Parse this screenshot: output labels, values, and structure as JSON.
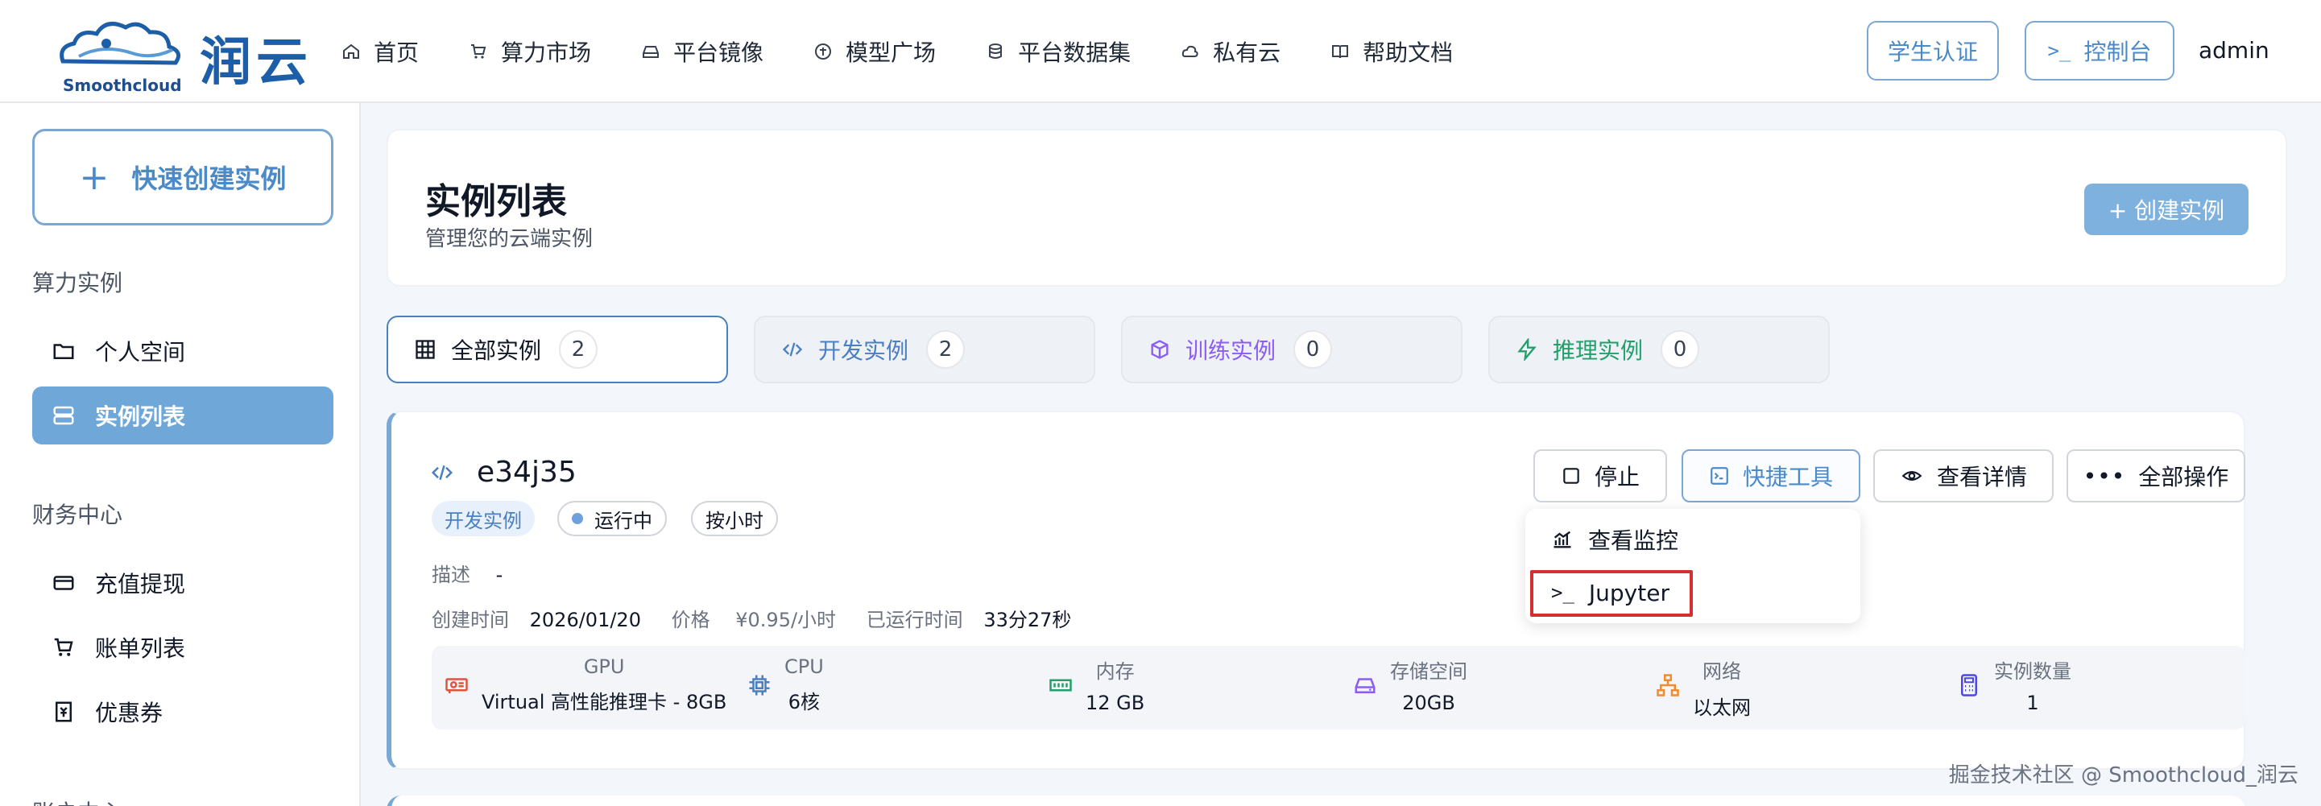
{
  "brand": {
    "name_cn": "润云",
    "name_en": "Smoothcloud"
  },
  "nav": {
    "items": [
      {
        "label": "首页",
        "icon": "home-icon"
      },
      {
        "label": "算力市场",
        "icon": "cart-icon"
      },
      {
        "label": "平台镜像",
        "icon": "drive-icon"
      },
      {
        "label": "模型广场",
        "icon": "model-icon"
      },
      {
        "label": "平台数据集",
        "icon": "database-icon"
      },
      {
        "label": "私有云",
        "icon": "cloud-icon"
      },
      {
        "label": "帮助文档",
        "icon": "book-icon"
      }
    ],
    "student_auth": "学生认证",
    "console": "控制台",
    "user": "admin"
  },
  "sidebar": {
    "quick_create": "快速创建实例",
    "sections": [
      {
        "title": "算力实例",
        "items": [
          "个人空间",
          "实例列表"
        ]
      },
      {
        "title": "财务中心",
        "items": [
          "充值提现",
          "账单列表",
          "优惠券"
        ]
      },
      {
        "title": "账户中心"
      }
    ],
    "active": "实例列表"
  },
  "page": {
    "title": "实例列表",
    "subtitle": "管理您的云端实例",
    "create_button": "+ 创建实例"
  },
  "tabs": [
    {
      "label": "全部实例",
      "count": "2",
      "color": "#111827"
    },
    {
      "label": "开发实例",
      "count": "2",
      "color": "#4a7fc1"
    },
    {
      "label": "训练实例",
      "count": "0",
      "color": "#8b5cf6"
    },
    {
      "label": "推理实例",
      "count": "0",
      "color": "#22a06b"
    }
  ],
  "instance": {
    "name": "e34j35",
    "type_badge": "开发实例",
    "status": "运行中",
    "billing": "按小时",
    "desc_label": "描述",
    "desc_value": "-",
    "created_label": "创建时间",
    "created_value": "2026/01/20",
    "price_label": "价格",
    "price_value": "¥0.95/小时",
    "runtime_label": "已运行时间",
    "runtime_value": "33分27秒",
    "actions": {
      "stop": "停止",
      "quick_tools": "快捷工具",
      "details": "查看详情",
      "all_ops": "全部操作"
    },
    "dropdown": {
      "monitor": "查看监控",
      "jupyter": "Jupyter"
    },
    "specs": [
      {
        "label": "GPU",
        "value": "Virtual 高性能推理卡 - 8GB",
        "icon": "gpu-icon",
        "color": "#e0533d"
      },
      {
        "label": "CPU",
        "value": "6核",
        "icon": "cpu-icon",
        "color": "#4a7fc1"
      },
      {
        "label": "内存",
        "value": "12 GB",
        "icon": "memory-icon",
        "color": "#22a06b"
      },
      {
        "label": "存储空间",
        "value": "20GB",
        "icon": "storage-icon",
        "color": "#8b5cf6"
      },
      {
        "label": "网络",
        "value": "以太网",
        "icon": "network-icon",
        "color": "#f08c2e"
      },
      {
        "label": "实例数量",
        "value": "1",
        "icon": "calculator-icon",
        "color": "#4f46e5"
      }
    ]
  },
  "watermark": "掘金技术社区 @ Smoothcloud_润云"
}
